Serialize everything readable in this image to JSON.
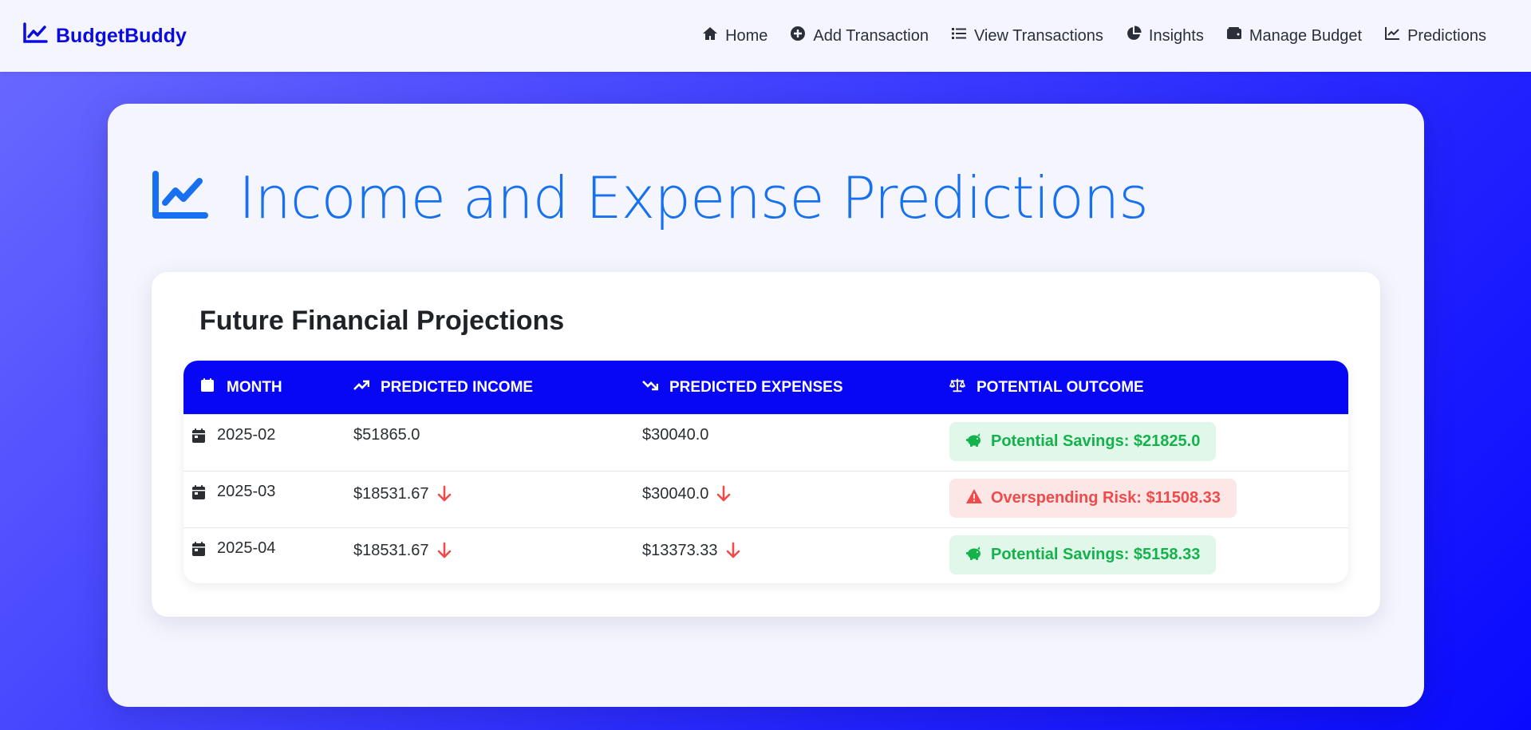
{
  "nav": {
    "brand": "BudgetBuddy",
    "links": [
      {
        "label": "Home",
        "icon": "home-icon"
      },
      {
        "label": "Add Transaction",
        "icon": "plus-circle-icon"
      },
      {
        "label": "View Transactions",
        "icon": "list-icon"
      },
      {
        "label": "Insights",
        "icon": "pie-chart-icon"
      },
      {
        "label": "Manage Budget",
        "icon": "wallet-icon"
      },
      {
        "label": "Predictions",
        "icon": "line-chart-icon"
      }
    ]
  },
  "page": {
    "title": "Income and Expense Predictions",
    "card_title": "Future Financial Projections"
  },
  "table": {
    "headers": {
      "month": "Month",
      "income": "Predicted Income",
      "expenses": "Predicted Expenses",
      "outcome": "Potential Outcome"
    },
    "rows": [
      {
        "month": "2025-02",
        "income": "$51865.0",
        "income_trend": "",
        "expenses": "$30040.0",
        "expenses_trend": "",
        "outcome": "Potential Savings: $21825.0",
        "outcome_type": "savings"
      },
      {
        "month": "2025-03",
        "income": "$18531.67",
        "income_trend": "down",
        "expenses": "$30040.0",
        "expenses_trend": "down",
        "outcome": "Overspending Risk: $11508.33",
        "outcome_type": "risk"
      },
      {
        "month": "2025-04",
        "income": "$18531.67",
        "income_trend": "down",
        "expenses": "$13373.33",
        "expenses_trend": "down",
        "outcome": "Potential Savings: $5158.33",
        "outcome_type": "savings"
      }
    ]
  },
  "colors": {
    "brand": "#0b0bde",
    "table_header": "#0707f5",
    "title": "#1670f0",
    "savings": "#13b24b",
    "risk": "#ef4b4b"
  }
}
